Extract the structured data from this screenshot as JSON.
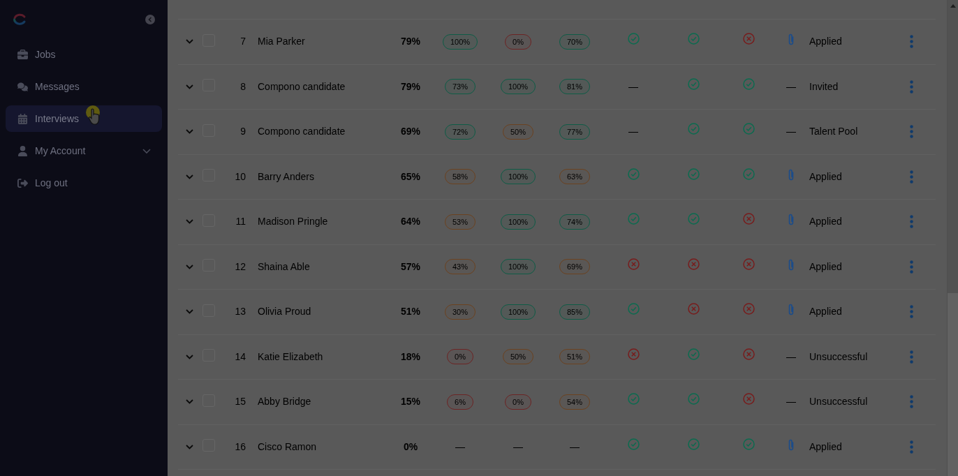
{
  "sidebar": {
    "items": [
      {
        "kind": "link",
        "label": "Jobs",
        "selected": false
      },
      {
        "kind": "link",
        "label": "Messages",
        "selected": false
      },
      {
        "kind": "link",
        "label": "Interviews",
        "selected": true
      },
      {
        "kind": "group",
        "label": "My Account",
        "selected": false,
        "expanded": false
      },
      {
        "kind": "link",
        "label": "Log out",
        "selected": false
      }
    ]
  },
  "table": {
    "rows": [
      {
        "expanded": false,
        "checked": false,
        "number": "7",
        "name": "Mia Parker",
        "total": "79%",
        "scores": [
          {
            "kind": "badge",
            "text": "100%",
            "color": "#0e5c46"
          },
          {
            "kind": "badge",
            "text": "0%",
            "color": "#6c2424"
          },
          {
            "kind": "badge",
            "text": "70%",
            "color": "#0e5c46"
          }
        ],
        "checks": [
          {
            "kind": "pass"
          },
          {
            "kind": "pass"
          },
          {
            "kind": "fail"
          }
        ],
        "attachment": {
          "kind": "clip"
        },
        "status": "Applied"
      },
      {
        "expanded": false,
        "checked": false,
        "number": "8",
        "name": "Compono candidate",
        "total": "79%",
        "scores": [
          {
            "kind": "badge",
            "text": "73%",
            "color": "#0e5c46"
          },
          {
            "kind": "badge",
            "text": "100%",
            "color": "#0e5c46"
          },
          {
            "kind": "badge",
            "text": "81%",
            "color": "#0e5c46"
          }
        ],
        "checks": [
          {
            "kind": "dash",
            "text": "—"
          },
          {
            "kind": "pass"
          },
          {
            "kind": "pass"
          }
        ],
        "attachment": {
          "kind": "dash",
          "text": "—"
        },
        "status": "Invited"
      },
      {
        "expanded": false,
        "checked": false,
        "number": "9",
        "name": "Compono candidate",
        "total": "69%",
        "scores": [
          {
            "kind": "badge",
            "text": "72%",
            "color": "#0e5c46"
          },
          {
            "kind": "badge",
            "text": "50%",
            "color": "#6b4220"
          },
          {
            "kind": "badge",
            "text": "77%",
            "color": "#0e5c46"
          }
        ],
        "checks": [
          {
            "kind": "dash",
            "text": "—"
          },
          {
            "kind": "pass"
          },
          {
            "kind": "pass"
          }
        ],
        "attachment": {
          "kind": "dash",
          "text": "—"
        },
        "status": "Talent Pool"
      },
      {
        "expanded": false,
        "checked": false,
        "number": "10",
        "name": "Barry Anders",
        "total": "65%",
        "scores": [
          {
            "kind": "badge",
            "text": "58%",
            "color": "#6b4220"
          },
          {
            "kind": "badge",
            "text": "100%",
            "color": "#0e5c46"
          },
          {
            "kind": "badge",
            "text": "63%",
            "color": "#6b4220"
          }
        ],
        "checks": [
          {
            "kind": "pass"
          },
          {
            "kind": "pass"
          },
          {
            "kind": "pass"
          }
        ],
        "attachment": {
          "kind": "clip"
        },
        "status": "Applied"
      },
      {
        "expanded": false,
        "checked": false,
        "number": "11",
        "name": "Madison Pringle",
        "total": "64%",
        "scores": [
          {
            "kind": "badge",
            "text": "53%",
            "color": "#6b4220"
          },
          {
            "kind": "badge",
            "text": "100%",
            "color": "#0e5c46"
          },
          {
            "kind": "badge",
            "text": "74%",
            "color": "#0e5c46"
          }
        ],
        "checks": [
          {
            "kind": "pass"
          },
          {
            "kind": "pass"
          },
          {
            "kind": "fail"
          }
        ],
        "attachment": {
          "kind": "clip"
        },
        "status": "Applied"
      },
      {
        "expanded": false,
        "checked": false,
        "number": "12",
        "name": "Shaina Able",
        "total": "57%",
        "scores": [
          {
            "kind": "badge",
            "text": "43%",
            "color": "#6b4220"
          },
          {
            "kind": "badge",
            "text": "100%",
            "color": "#0e5c46"
          },
          {
            "kind": "badge",
            "text": "69%",
            "color": "#6b4220"
          }
        ],
        "checks": [
          {
            "kind": "fail"
          },
          {
            "kind": "fail"
          },
          {
            "kind": "fail"
          }
        ],
        "attachment": {
          "kind": "clip"
        },
        "status": "Applied"
      },
      {
        "expanded": false,
        "checked": false,
        "number": "13",
        "name": "Olivia Proud",
        "total": "51%",
        "scores": [
          {
            "kind": "badge",
            "text": "30%",
            "color": "#6b4220"
          },
          {
            "kind": "badge",
            "text": "100%",
            "color": "#0e5c46"
          },
          {
            "kind": "badge",
            "text": "85%",
            "color": "#0e5c46"
          }
        ],
        "checks": [
          {
            "kind": "pass"
          },
          {
            "kind": "fail"
          },
          {
            "kind": "fail"
          }
        ],
        "attachment": {
          "kind": "clip"
        },
        "status": "Applied"
      },
      {
        "expanded": false,
        "checked": false,
        "number": "14",
        "name": "Katie Elizabeth",
        "total": "18%",
        "scores": [
          {
            "kind": "badge",
            "text": "0%",
            "color": "#6c2424"
          },
          {
            "kind": "badge",
            "text": "50%",
            "color": "#6b4220"
          },
          {
            "kind": "badge",
            "text": "51%",
            "color": "#6b4220"
          }
        ],
        "checks": [
          {
            "kind": "fail"
          },
          {
            "kind": "pass"
          },
          {
            "kind": "fail"
          }
        ],
        "attachment": {
          "kind": "dash",
          "text": "—"
        },
        "status": "Unsuccessful"
      },
      {
        "expanded": false,
        "checked": false,
        "number": "15",
        "name": "Abby Bridge",
        "total": "15%",
        "scores": [
          {
            "kind": "badge",
            "text": "6%",
            "color": "#6c2424"
          },
          {
            "kind": "badge",
            "text": "0%",
            "color": "#6c2424"
          },
          {
            "kind": "badge",
            "text": "54%",
            "color": "#6b4220"
          }
        ],
        "checks": [
          {
            "kind": "pass"
          },
          {
            "kind": "pass"
          },
          {
            "kind": "fail"
          }
        ],
        "attachment": {
          "kind": "dash",
          "text": "—"
        },
        "status": "Unsuccessful"
      },
      {
        "expanded": false,
        "checked": false,
        "number": "16",
        "name": "Cisco Ramon",
        "total": "0%",
        "scores": [
          {
            "kind": "dash",
            "text": "—"
          },
          {
            "kind": "dash",
            "text": "—"
          },
          {
            "kind": "dash",
            "text": "—"
          }
        ],
        "checks": [
          {
            "kind": "pass"
          },
          {
            "kind": "pass"
          },
          {
            "kind": "pass"
          }
        ],
        "attachment": {
          "kind": "clip"
        },
        "status": "Applied"
      }
    ]
  }
}
